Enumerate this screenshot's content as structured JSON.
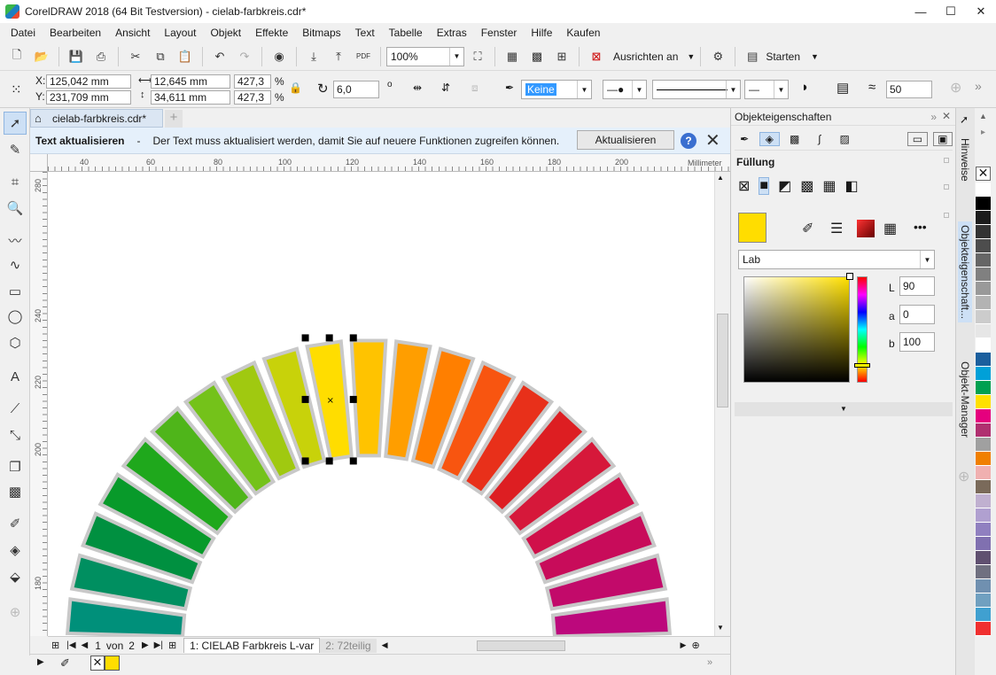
{
  "window": {
    "title": "CorelDRAW 2018 (64 Bit Testversion) - cielab-farbkreis.cdr*",
    "controls": [
      "—",
      "☐",
      "✕"
    ]
  },
  "menu": [
    "Datei",
    "Bearbeiten",
    "Ansicht",
    "Layout",
    "Objekt",
    "Effekte",
    "Bitmaps",
    "Text",
    "Tabelle",
    "Extras",
    "Fenster",
    "Hilfe",
    "Kaufen"
  ],
  "toolbar": {
    "zoom": "100%",
    "align_label": "Ausrichten an",
    "start_label": "Starten"
  },
  "props": {
    "x_label": "X:",
    "x_value": "125,042 mm",
    "y_label": "Y:",
    "y_value": "231,709 mm",
    "w_value": "12,645 mm",
    "h_value": "34,611 mm",
    "scale_w": "427,3",
    "scale_h": "427,3",
    "pct": "%",
    "rotation": "6,0",
    "fill_none": "Keine",
    "curve_value": "50"
  },
  "doc_tab": "cielab-farbkreis.cdr*",
  "infobar": {
    "title": "Text aktualisieren",
    "dash": "-",
    "message": "Der Text muss aktualisiert werden, damit Sie auf neuere Funktionen zugreifen können.",
    "button": "Aktualisieren"
  },
  "ruler_h": [
    "40",
    "60",
    "80",
    "100",
    "120",
    "140",
    "160",
    "180",
    "200"
  ],
  "ruler_unit": "Millimeter",
  "ruler_v": [
    "280",
    "240",
    "220",
    "200",
    "180"
  ],
  "pages": {
    "current": "1",
    "of_label": "von",
    "total": "2",
    "page1": "1: CIELAB Farbkreis L-var",
    "page2": "2: 72teilig"
  },
  "docker": {
    "title": "Objekteigenschaften",
    "fill_section": "Füllung",
    "color_model": "Lab",
    "L_label": "L",
    "L_value": "90",
    "a_label": "a",
    "a_value": "0",
    "b_label": "b",
    "b_value": "100",
    "current_color": "#ffdd00"
  },
  "side_tabs": [
    "Hinweise",
    "Objekteigenschaft...",
    "Objekt-Manager"
  ],
  "wheel": {
    "colors": [
      "#008a7a",
      "#00907a",
      "#008f60",
      "#009040",
      "#089a2a",
      "#1fa81c",
      "#4fb51a",
      "#74c21a",
      "#a0c910",
      "#c8d20a",
      "#ffdd00",
      "#ffc300",
      "#ff9e00",
      "#ff7f00",
      "#f85510",
      "#e8301a",
      "#dd1e22",
      "#d6183a",
      "#d0104a",
      "#c80c5a",
      "#c20a6a",
      "#bc087c",
      "#b8088c"
    ],
    "selected_index": 10
  },
  "palette": [
    "#ffffff",
    "#000000",
    "#1c1c1c",
    "#333333",
    "#4d4d4d",
    "#666666",
    "#808080",
    "#999999",
    "#b3b3b3",
    "#cccccc",
    "#e6e6e6",
    "#ffffff",
    "#1b5f9e",
    "#00a0d8",
    "#00a050",
    "#ffe000",
    "#e5007e",
    "#b03070",
    "#a0a0a0",
    "#f07f00",
    "#f0b0b0",
    "#7a6a5a",
    "#c0b0d0",
    "#b0a0d0",
    "#9080c0",
    "#8070b0",
    "#605070",
    "#707080",
    "#7090b0",
    "#70a0c0",
    "#40a0d0",
    "#f03030"
  ]
}
